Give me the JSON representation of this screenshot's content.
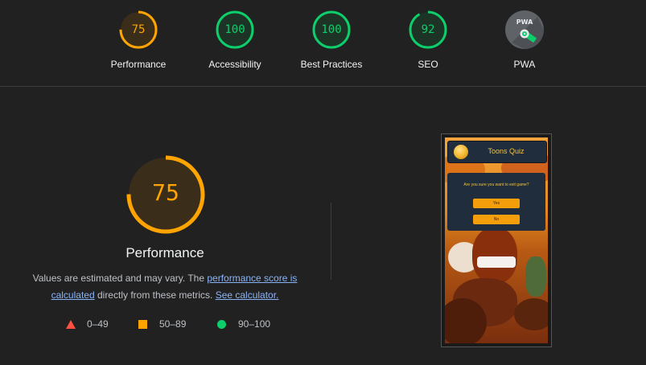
{
  "scores": [
    {
      "label": "Performance",
      "value": "75",
      "score": 75,
      "color": "#ffa400"
    },
    {
      "label": "Accessibility",
      "value": "100",
      "score": 100,
      "color": "#0cce6b"
    },
    {
      "label": "Best Practices",
      "value": "100",
      "score": 100,
      "color": "#0cce6b"
    },
    {
      "label": "SEO",
      "value": "92",
      "score": 92,
      "color": "#0cce6b"
    }
  ],
  "pwa": {
    "label": "PWA",
    "badge_text": "PWA"
  },
  "performance": {
    "score": "75",
    "title": "Performance",
    "desc_prefix": "Values are estimated and may vary. The ",
    "score_link": "performance score is calculated",
    "desc_middle": " directly from these metrics. ",
    "calc_link": "See calculator."
  },
  "legend": [
    {
      "range": "0–49",
      "shape": "triangle",
      "color": "#ff4e42"
    },
    {
      "range": "50–89",
      "shape": "square",
      "color": "#ffa400"
    },
    {
      "range": "90–100",
      "shape": "circle",
      "color": "#0cce6b"
    }
  ],
  "screenshot": {
    "title": "Toons Quiz",
    "question": "Are you sure you want to exit game?",
    "yes_label": "Yes",
    "no_label": "No"
  }
}
